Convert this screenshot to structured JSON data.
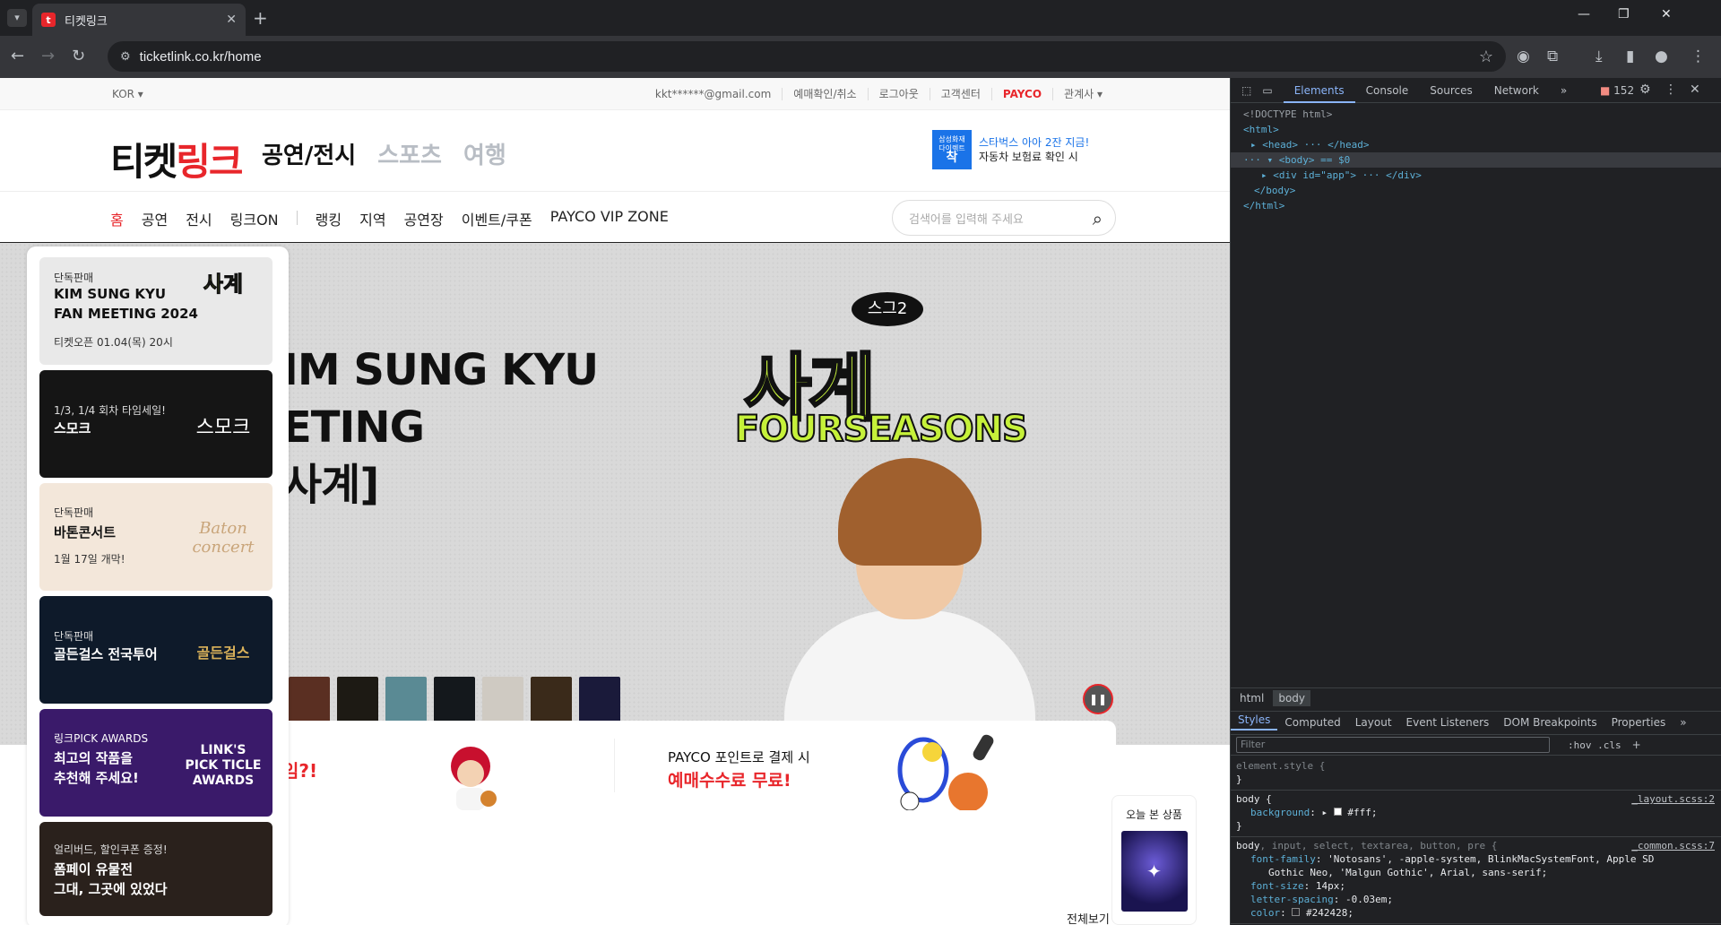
{
  "browser": {
    "tab_title": "티켓링크",
    "url": "ticketlink.co.kr/home",
    "new_tab": "+",
    "close_tab": "✕"
  },
  "site": {
    "lang": "KOR ▾",
    "util_links": [
      "kkt******@gmail.com",
      "예매확인/취소",
      "로그아웃",
      "고객센터",
      "PAYCO",
      "관계사 ▾"
    ],
    "logo_black": "티켓",
    "logo_red": "링크",
    "categories": [
      "공연/전시",
      "스포츠",
      "여행"
    ],
    "header_ad": {
      "line1": "스타벅스 아아 2잔 지금!",
      "line2": "자동차 보험료 확인 시"
    },
    "gnb": [
      "홈",
      "공연",
      "전시",
      "링크ON",
      "랭킹",
      "지역",
      "공연장",
      "이벤트/쿠폰",
      "PAYCO VIP ZONE"
    ],
    "search_placeholder": "검색어를 입력해 주세요",
    "hero": {
      "title_line1": "IM SUNG KYU",
      "title_line2": "ETING",
      "title_line3": "사계]",
      "badge": "스그2",
      "logo_ko": "사계",
      "logo_en": "FOURSEASONS"
    },
    "side_cards": [
      {
        "small": "단독판매",
        "title": "KIM SUNG KYU\nFAN MEETING 2024",
        "sub": "티켓오픈 01.04(목) 20시",
        "bg": "#e9e9e9",
        "dark": false
      },
      {
        "small": "1/3, 1/4 회차 타임세일!",
        "title": "스모크",
        "sub": "",
        "bg": "#151515",
        "dark": true
      },
      {
        "small": "단독판매",
        "title": "바톤콘서트",
        "sub": "1월 17일 개막!",
        "bg": "#f3e7da",
        "dark": false
      },
      {
        "small": "단독판매",
        "title": "골든걸스 전국투어",
        "sub": "",
        "bg": "#0e1a2a",
        "dark": true
      },
      {
        "small": "링크PICK AWARDS",
        "title": "최고의 작품을\n추천해 주세요!",
        "sub": "",
        "bg": "#3a1a6a",
        "dark": true
      },
      {
        "small": "얼리버드, 할인쿠폰 증정!",
        "title": "폼페이 유물전\n그대, 그곳에 있었다",
        "sub": "",
        "bg": "#2a211c",
        "dark": true
      }
    ],
    "side_card_art": [
      "사계",
      "스모크",
      "Baton concert",
      "골든걸스",
      "LINK'S PICK TICLE AWARDS",
      ""
    ],
    "promo": {
      "left_text": "임?!",
      "right_small": "PAYCO 포인트로 결제 시",
      "right_big": "예매수수료 무료!"
    },
    "recent_title": "오늘 본 상품",
    "view_all": "전체보기"
  },
  "devtools": {
    "tabs": [
      "Elements",
      "Console",
      "Sources",
      "Network"
    ],
    "issues": "152",
    "dom": [
      "<!DOCTYPE html>",
      "<html>",
      "<head> ··· </head>",
      "<body> == $0",
      "<div id=\"app\"> ··· </div>",
      "</body>",
      "</html>"
    ],
    "crumbs": [
      "html",
      "body"
    ],
    "styles_tabs": [
      "Styles",
      "Computed",
      "Layout",
      "Event Listeners",
      "DOM Breakpoints",
      "Properties"
    ],
    "filter_placeholder": "Filter",
    "filter_tools": ":hov  .cls",
    "rule1": {
      "selector": "element.style {",
      "close": "}"
    },
    "rule2": {
      "selector": "body {",
      "src": "_layout.scss:2",
      "prop": "background",
      "val": "#fff;",
      "close": "}"
    },
    "rule3": {
      "selector": "body",
      "selector_rest": ", input, select, textarea, button, pre {",
      "src": "_common.scss:7",
      "p1": "font-family",
      "v1": "'Notosans', -apple-system, BlinkMacSystemFont, Apple SD",
      "v1b": "Gothic Neo, 'Malgun Gothic', Arial, sans-serif;",
      "p2": "font-size",
      "v2": "14px;",
      "p3": "letter-spacing",
      "v3": "-0.03em;",
      "p4": "color",
      "v4": "#242428;"
    }
  },
  "colors": {
    "brand_red": "#e8262b",
    "devtools_bg": "#202124",
    "chrome_bg": "#35363a"
  }
}
